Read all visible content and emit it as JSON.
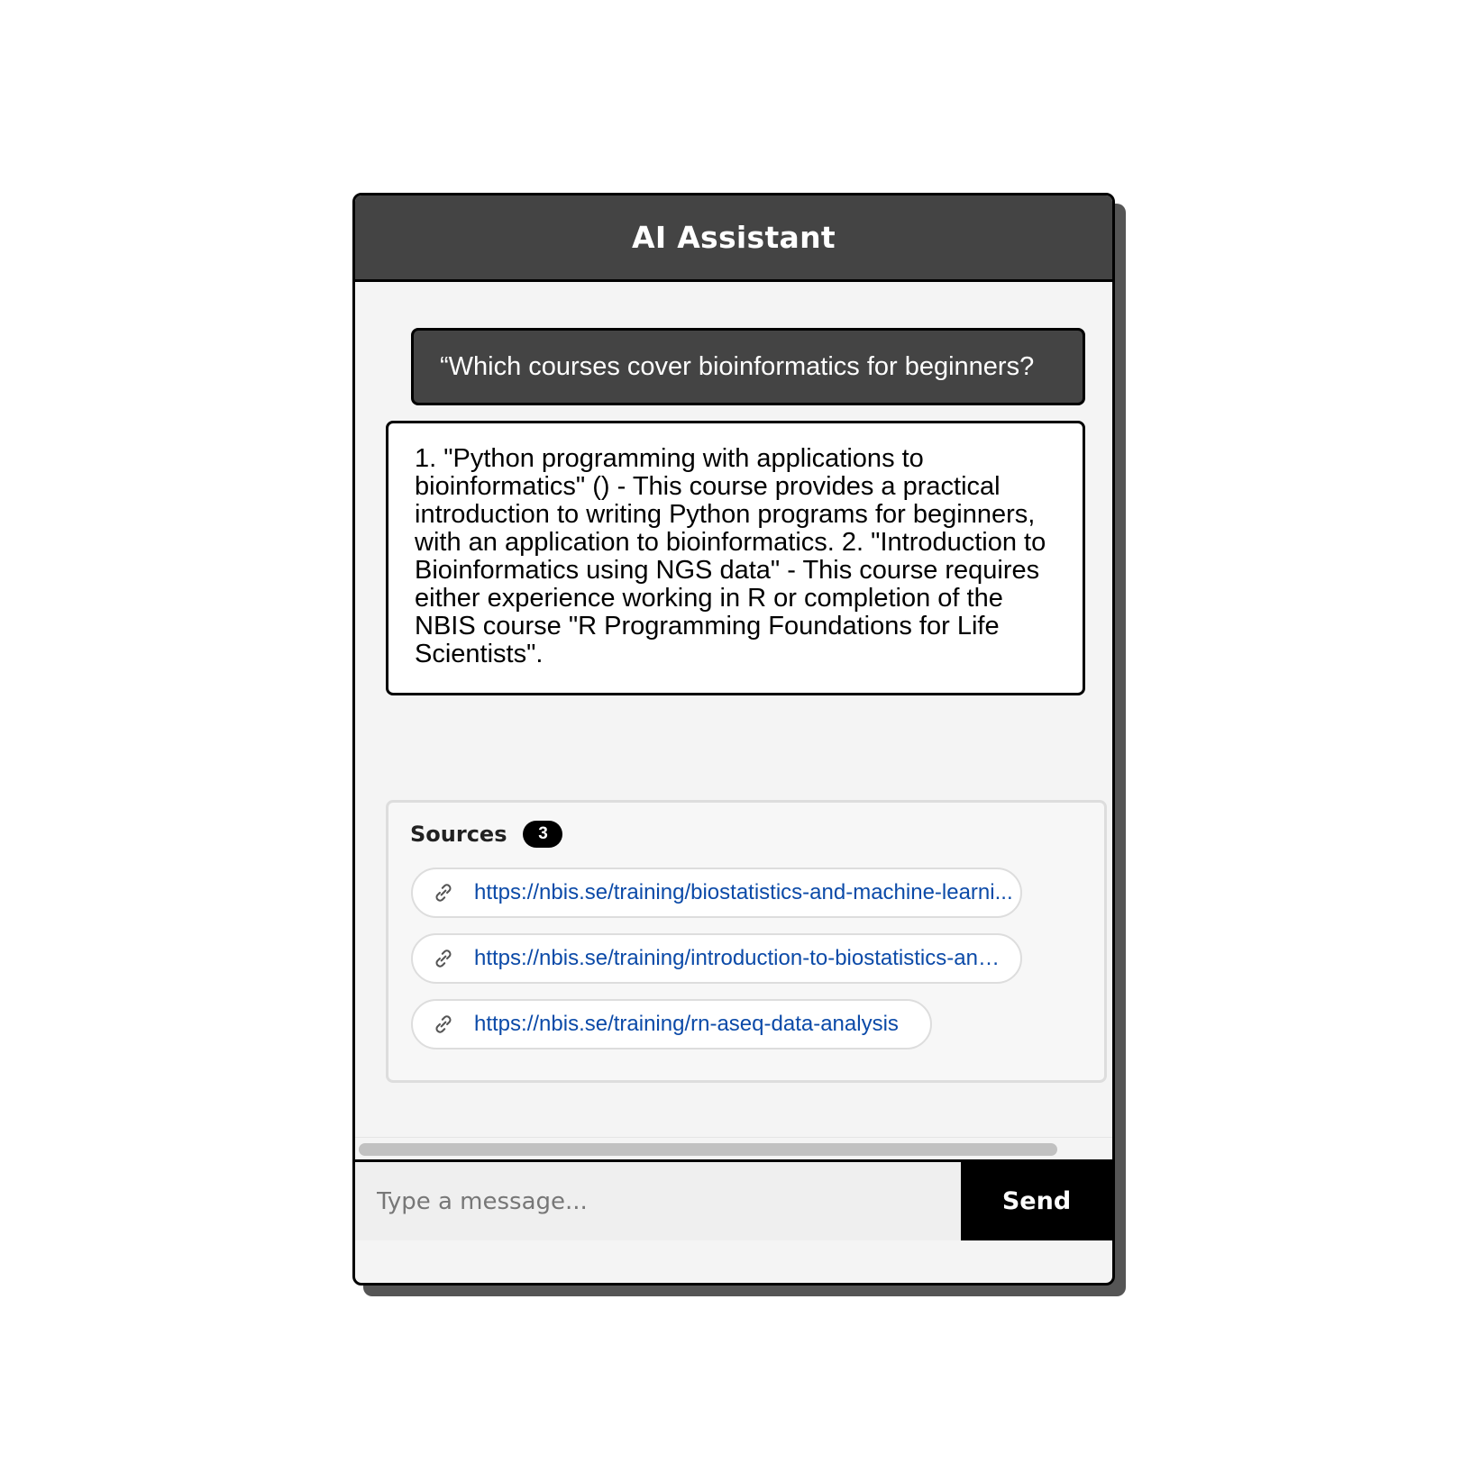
{
  "header": {
    "title": "AI Assistant"
  },
  "conversation": {
    "user_message": "“Which courses cover bioinformatics for beginners?",
    "assistant_message": "1. \"Python programming with applications to bioinformatics\" () - This course provides a practical introduction to writing Python programs for beginners, with an application to bioinformatics. 2. \"Introduction to Bioinformatics using NGS data\" - This course requires either experience working in R or completion of the NBIS course \"R Programming Foundations for Life Scientists\"."
  },
  "sources": {
    "label": "Sources",
    "count": "3",
    "items": [
      {
        "url": "https://nbis.se/training/biostatistics-and-machine-learni...",
        "icon": "link-icon"
      },
      {
        "url": "https://nbis.se/training/introduction-to-biostatistics-an…",
        "icon": "link-icon"
      },
      {
        "url": "https://nbis.se/training/rn-aseq-data-analysis",
        "icon": "link-icon"
      }
    ]
  },
  "input": {
    "placeholder": "Type a message...",
    "value": ""
  },
  "send_button": {
    "label": "Send"
  },
  "colors": {
    "header_bg": "#444444",
    "user_bubble_bg": "#444444",
    "link": "#0b4aa8",
    "send_bg": "#000000"
  }
}
